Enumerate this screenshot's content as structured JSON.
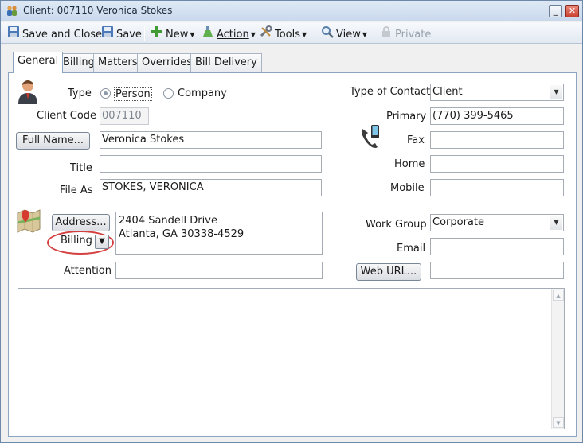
{
  "window": {
    "title": "Client: 007110 Veronica Stokes",
    "controls": {
      "minimize": "_",
      "maximize": "□",
      "close": "✕"
    }
  },
  "toolbar": {
    "save_close": "Save and Close",
    "save": "Save",
    "new": "New",
    "action": "Action",
    "tools": "Tools",
    "view": "View",
    "private": "Private"
  },
  "tabs": [
    {
      "label": "General",
      "active": true
    },
    {
      "label": "Billing"
    },
    {
      "label": "Matters"
    },
    {
      "label": "Overrides"
    },
    {
      "label": "Bill Delivery"
    }
  ],
  "general": {
    "type_label": "Type",
    "type_options": [
      "Person",
      "Company"
    ],
    "type_selected": "Person",
    "client_code_label": "Client Code",
    "client_code_value": "007110",
    "full_name_button": "Full Name...",
    "full_name_value": "Veronica Stokes",
    "title_label": "Title",
    "title_value": "",
    "file_as_label": "File As",
    "file_as_value": "STOKES, VERONICA",
    "type_of_contact_label": "Type of Contact",
    "type_of_contact_value": "Client",
    "primary_label": "Primary",
    "primary_value": "(770) 399-5465",
    "fax_label": "Fax",
    "fax_value": "",
    "home_label": "Home",
    "home_value": "",
    "mobile_label": "Mobile",
    "mobile_value": "",
    "address_button": "Address...",
    "address_type": "Billing",
    "address_value": "2404 Sandell Drive\nAtlanta, GA 30338-4529",
    "attention_label": "Attention",
    "attention_value": "",
    "work_group_label": "Work Group",
    "work_group_value": "Corporate",
    "email_label": "Email",
    "email_value": "",
    "web_url_button": "Web URL...",
    "web_url_value": "",
    "notes_value": ""
  },
  "icons": {
    "app": "people-icon",
    "person": "person-icon",
    "phone": "phone-icon",
    "map": "map-pin-icon"
  }
}
